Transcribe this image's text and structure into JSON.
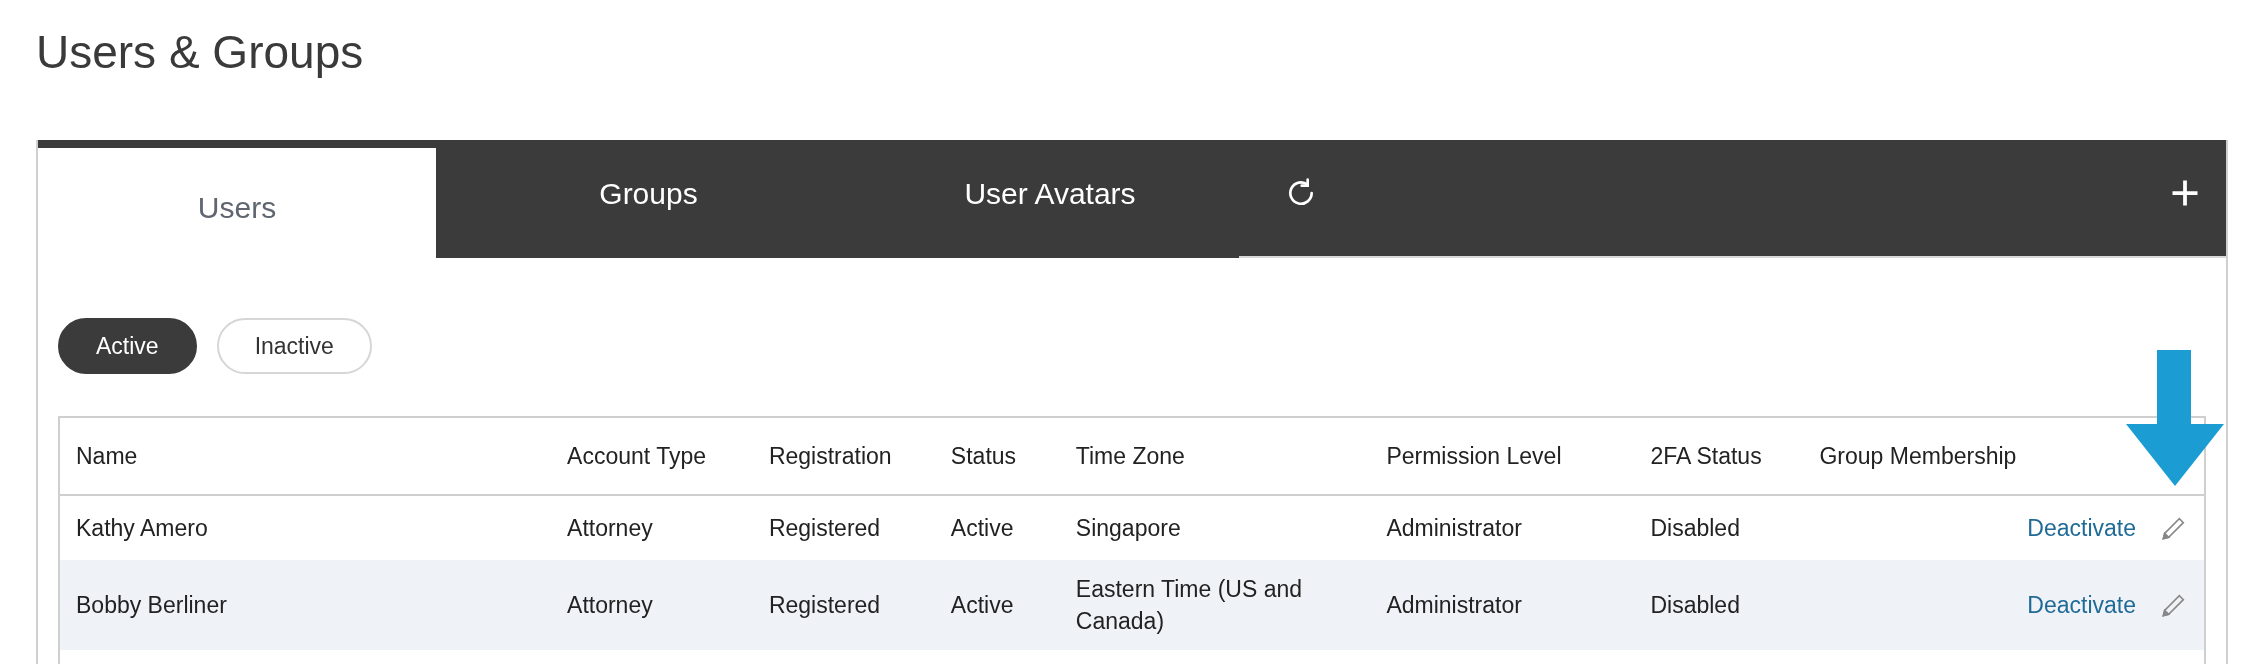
{
  "page_title": "Users & Groups",
  "tabs": [
    {
      "label": "Users",
      "selected": true
    },
    {
      "label": "Groups",
      "selected": false
    },
    {
      "label": "User Avatars",
      "selected": false
    }
  ],
  "filters": [
    {
      "label": "Active",
      "selected": true
    },
    {
      "label": "Inactive",
      "selected": false
    }
  ],
  "table": {
    "columns": [
      "Name",
      "Account Type",
      "Registration",
      "Status",
      "Time Zone",
      "Permission Level",
      "2FA Status",
      "Group Membership"
    ],
    "rows": [
      {
        "cells": [
          "Kathy Amero",
          "Attorney",
          "Registered",
          "Active",
          "Singapore",
          "Administrator",
          "Disabled",
          ""
        ],
        "action": "Deactivate"
      },
      {
        "cells": [
          "Bobby Berliner",
          "Attorney",
          "Registered",
          "Active",
          "Eastern Time (US and Canada)",
          "Administrator",
          "Disabled",
          ""
        ],
        "action": "Deactivate"
      }
    ]
  }
}
